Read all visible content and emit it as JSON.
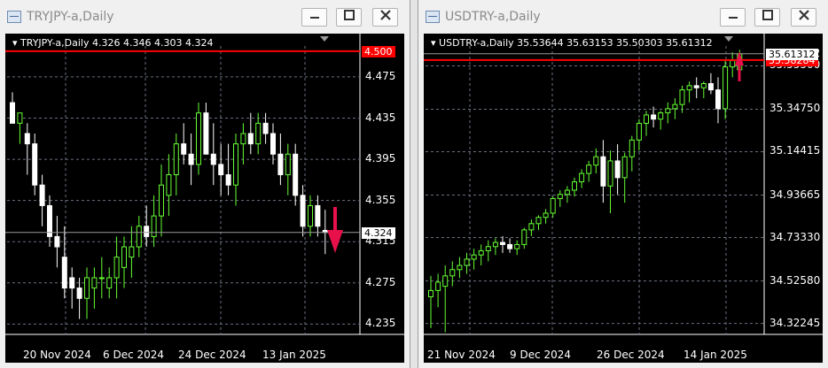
{
  "windows": [
    {
      "title": "TRYJPY-a,Daily",
      "header": "TRYJPY-a,Daily  4.326 4.346 4.303 4.324",
      "chart_data": {
        "type": "candlestick",
        "symbol": "TRYJPY-a",
        "timeframe": "Daily",
        "ohlc": {
          "open": 4.326,
          "high": 4.346,
          "low": 4.303,
          "close": 4.324
        },
        "y_ticks": [
          "4.475",
          "4.435",
          "4.395",
          "4.355",
          "4.315",
          "4.275",
          "4.235"
        ],
        "y_range": [
          4.225,
          4.505
        ],
        "x_ticks": [
          "20 Nov 2024",
          "6 Dec 2024",
          "24 Dec 2024",
          "13 Jan 2025"
        ],
        "current_price": "4.324",
        "alert_level": "4.500",
        "signal": "down",
        "candles": [
          [
            4.45,
            4.46,
            4.43,
            4.43
          ],
          [
            4.43,
            4.44,
            4.41,
            4.44
          ],
          [
            4.42,
            4.43,
            4.38,
            4.41
          ],
          [
            4.41,
            4.42,
            4.36,
            4.37
          ],
          [
            4.37,
            4.38,
            4.33,
            4.35
          ],
          [
            4.35,
            4.36,
            4.31,
            4.32
          ],
          [
            4.32,
            4.34,
            4.29,
            4.31
          ],
          [
            4.3,
            4.33,
            4.26,
            4.27
          ],
          [
            4.28,
            4.29,
            4.25,
            4.27
          ],
          [
            4.27,
            4.28,
            4.24,
            4.26
          ],
          [
            4.26,
            4.29,
            4.24,
            4.28
          ],
          [
            4.27,
            4.29,
            4.25,
            4.28
          ],
          [
            4.28,
            4.3,
            4.26,
            4.28
          ],
          [
            4.27,
            4.29,
            4.26,
            4.28
          ],
          [
            4.28,
            4.32,
            4.26,
            4.3
          ],
          [
            4.29,
            4.32,
            4.27,
            4.31
          ],
          [
            4.3,
            4.33,
            4.28,
            4.31
          ],
          [
            4.31,
            4.34,
            4.3,
            4.33
          ],
          [
            4.33,
            4.35,
            4.31,
            4.32
          ],
          [
            4.32,
            4.36,
            4.31,
            4.34
          ],
          [
            4.34,
            4.39,
            4.32,
            4.37
          ],
          [
            4.36,
            4.4,
            4.34,
            4.38
          ],
          [
            4.38,
            4.42,
            4.36,
            4.41
          ],
          [
            4.41,
            4.43,
            4.39,
            4.4
          ],
          [
            4.4,
            4.42,
            4.37,
            4.39
          ],
          [
            4.39,
            4.45,
            4.38,
            4.44
          ],
          [
            4.44,
            4.45,
            4.4,
            4.4
          ],
          [
            4.4,
            4.43,
            4.37,
            4.39
          ],
          [
            4.39,
            4.41,
            4.36,
            4.38
          ],
          [
            4.38,
            4.41,
            4.36,
            4.37
          ],
          [
            4.37,
            4.42,
            4.35,
            4.41
          ],
          [
            4.41,
            4.43,
            4.39,
            4.42
          ],
          [
            4.42,
            4.44,
            4.4,
            4.41
          ],
          [
            4.41,
            4.44,
            4.4,
            4.43
          ],
          [
            4.43,
            4.44,
            4.41,
            4.42
          ],
          [
            4.42,
            4.43,
            4.39,
            4.4
          ],
          [
            4.4,
            4.42,
            4.37,
            4.38
          ],
          [
            4.38,
            4.41,
            4.36,
            4.4
          ],
          [
            4.4,
            4.41,
            4.35,
            4.36
          ],
          [
            4.36,
            4.37,
            4.32,
            4.33
          ],
          [
            4.33,
            4.36,
            4.32,
            4.35
          ],
          [
            4.35,
            4.36,
            4.32,
            4.33
          ],
          [
            4.326,
            4.346,
            4.303,
            4.324
          ]
        ]
      }
    },
    {
      "title": "USDTRY-a,Daily",
      "header": "USDTRY-a,Daily  35.53644 35.63153 35.50303 35.61312",
      "chart_data": {
        "type": "candlestick",
        "symbol": "USDTRY-a",
        "timeframe": "Daily",
        "ohlc": {
          "open": 35.53644,
          "high": 35.63153,
          "low": 35.50303,
          "close": 35.61312
        },
        "y_ticks": [
          "35.61312",
          "35.55500",
          "35.34750",
          "35.14415",
          "34.93665",
          "34.73330",
          "34.52580",
          "34.32245"
        ],
        "y_range": [
          34.27,
          35.65
        ],
        "x_ticks": [
          "21 Nov 2024",
          "9 Dec 2024",
          "26 Dec 2024",
          "14 Jan 2025"
        ],
        "current_price": "35.61312",
        "alert_level": "35.58284",
        "signal": "up",
        "candles": [
          [
            34.45,
            34.55,
            34.3,
            34.48
          ],
          [
            34.48,
            34.56,
            34.4,
            34.52
          ],
          [
            34.5,
            34.6,
            34.28,
            34.55
          ],
          [
            34.55,
            34.62,
            34.5,
            34.58
          ],
          [
            34.58,
            34.64,
            34.54,
            34.6
          ],
          [
            34.6,
            34.66,
            34.56,
            34.63
          ],
          [
            34.63,
            34.68,
            34.58,
            34.65
          ],
          [
            34.65,
            34.7,
            34.6,
            34.67
          ],
          [
            34.67,
            34.72,
            34.62,
            34.69
          ],
          [
            34.69,
            34.73,
            34.65,
            34.71
          ],
          [
            34.71,
            34.74,
            34.66,
            34.7
          ],
          [
            34.7,
            34.73,
            34.66,
            34.68
          ],
          [
            34.68,
            34.72,
            34.65,
            34.7
          ],
          [
            34.7,
            34.78,
            34.68,
            34.77
          ],
          [
            34.77,
            34.82,
            34.74,
            34.8
          ],
          [
            34.8,
            34.84,
            34.77,
            34.83
          ],
          [
            34.83,
            34.87,
            34.8,
            34.85
          ],
          [
            34.85,
            34.93,
            34.83,
            34.92
          ],
          [
            34.92,
            34.96,
            34.88,
            34.94
          ],
          [
            34.94,
            34.98,
            34.9,
            34.96
          ],
          [
            34.96,
            35.02,
            34.93,
            35.0
          ],
          [
            35.0,
            35.06,
            34.97,
            35.04
          ],
          [
            35.04,
            35.1,
            35.0,
            35.08
          ],
          [
            35.08,
            35.16,
            35.04,
            35.12
          ],
          [
            35.12,
            35.2,
            34.9,
            34.98
          ],
          [
            34.98,
            35.15,
            34.85,
            35.1
          ],
          [
            35.1,
            35.18,
            34.94,
            35.02
          ],
          [
            35.02,
            35.14,
            34.9,
            35.12
          ],
          [
            35.12,
            35.22,
            35.05,
            35.2
          ],
          [
            35.2,
            35.3,
            35.15,
            35.28
          ],
          [
            35.28,
            35.34,
            35.22,
            35.32
          ],
          [
            35.32,
            35.36,
            35.26,
            35.3
          ],
          [
            35.3,
            35.34,
            35.25,
            35.33
          ],
          [
            35.33,
            35.38,
            35.28,
            35.35
          ],
          [
            35.35,
            35.4,
            35.3,
            35.37
          ],
          [
            35.37,
            35.46,
            35.33,
            35.44
          ],
          [
            35.44,
            35.48,
            35.38,
            35.46
          ],
          [
            35.46,
            35.5,
            35.4,
            35.45
          ],
          [
            35.45,
            35.48,
            35.4,
            35.47
          ],
          [
            35.47,
            35.52,
            35.42,
            35.44
          ],
          [
            35.44,
            35.5,
            35.28,
            35.35
          ],
          [
            35.35,
            35.58,
            35.3,
            35.55
          ],
          [
            35.55,
            35.62,
            35.5,
            35.58
          ],
          [
            35.53644,
            35.63153,
            35.50303,
            35.61312
          ]
        ]
      }
    }
  ],
  "colors": {
    "bull": "#66ff33",
    "bear": "#ffffff",
    "alert_line": "#ff0000",
    "arrow": "#e8104a",
    "grid": "#6a7080"
  },
  "icons": {
    "minimize": "minimize-icon",
    "maximize": "maximize-icon",
    "close": "close-icon"
  }
}
